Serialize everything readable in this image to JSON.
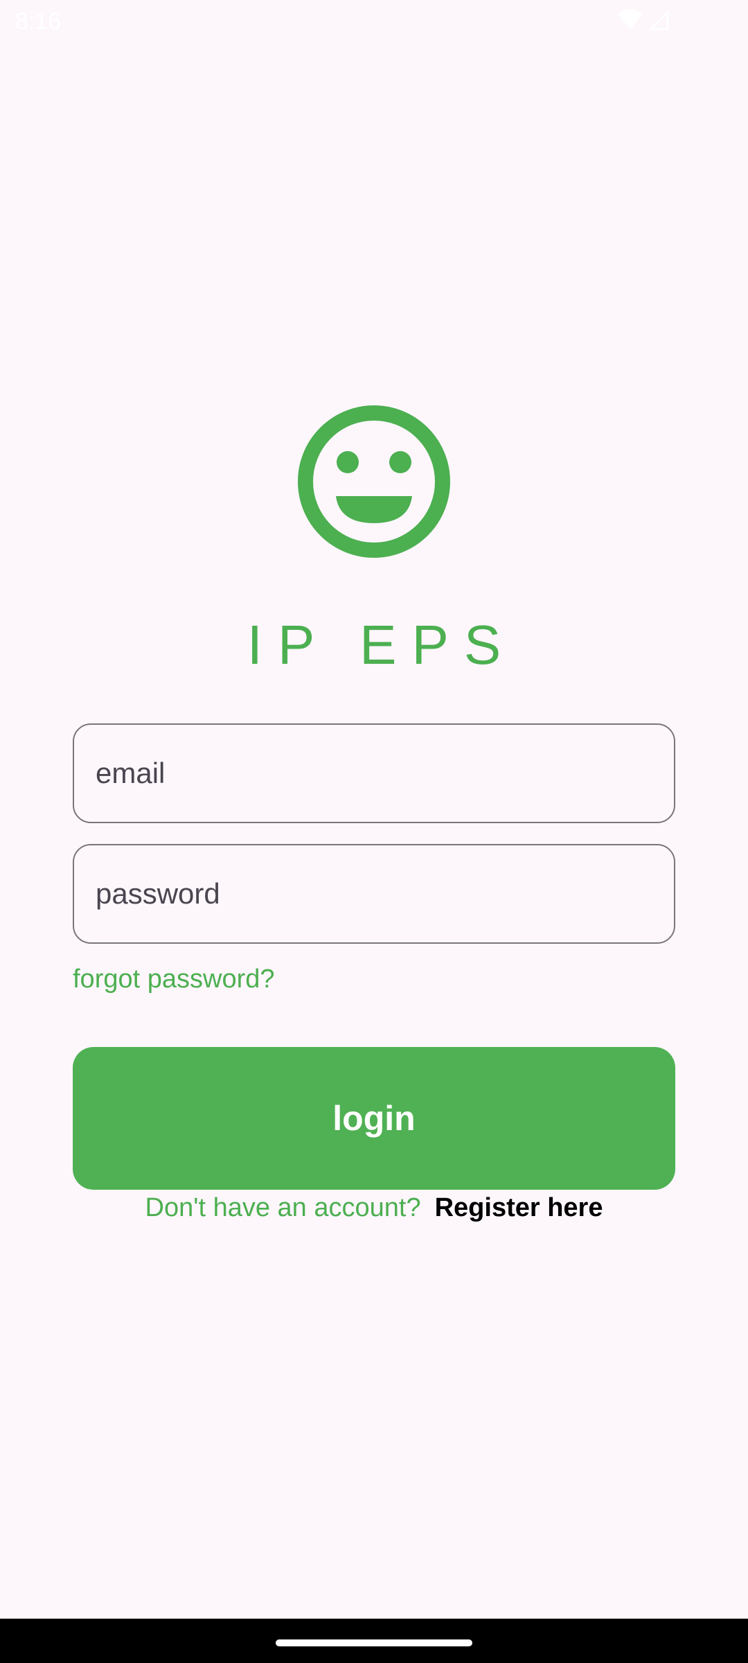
{
  "status_bar": {
    "time": "8:16",
    "icons": [
      "wifi-icon",
      "signal-icon"
    ]
  },
  "brand": {
    "logo_icon": "smiley-face-icon",
    "title": "IP EPS",
    "accent_color": "#4caf50"
  },
  "form": {
    "email_placeholder": "email",
    "email_value": "",
    "password_placeholder": "password",
    "password_value": "",
    "forgot_password_label": "forgot password?",
    "login_label": "login"
  },
  "register": {
    "prompt": "Don't have an account?",
    "link_label": "Register here"
  }
}
